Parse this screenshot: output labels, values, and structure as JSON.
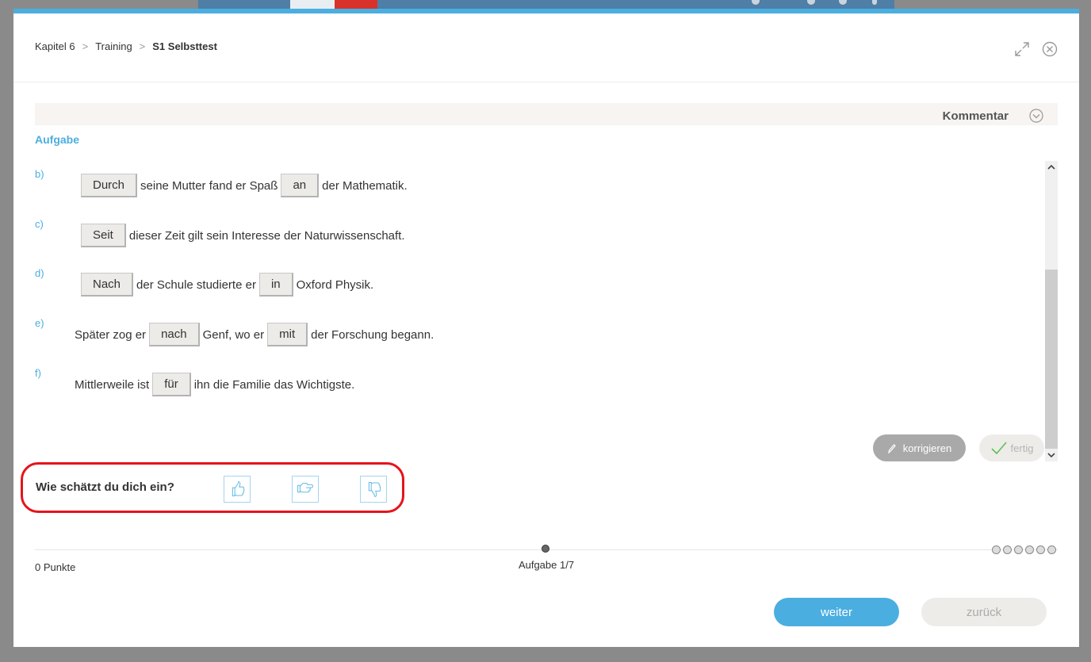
{
  "breadcrumb": [
    "Kapitel 6",
    "Training",
    "S1 Selbsttest"
  ],
  "icons": {
    "expand": "expand-icon",
    "close": "close-circle-icon",
    "chevron": "chevron-down-circle-icon",
    "pencil": "pencil-icon",
    "check": "check-icon"
  },
  "kommentar_label": "Kommentar",
  "aufgabe_label": "Aufgabe",
  "exercises": [
    {
      "label": "b)",
      "parts": [
        {
          "blank": "Durch"
        },
        {
          "text": "seine Mutter fand er Spaß"
        },
        {
          "blank": "an"
        },
        {
          "text": "der Mathematik."
        }
      ]
    },
    {
      "label": "c)",
      "parts": [
        {
          "blank": "Seit"
        },
        {
          "text": "dieser Zeit gilt sein Interesse der Naturwissenschaft."
        }
      ]
    },
    {
      "label": "d)",
      "parts": [
        {
          "blank": "Nach"
        },
        {
          "text": "der Schule studierte er"
        },
        {
          "blank": "in"
        },
        {
          "text": "Oxford Physik."
        }
      ]
    },
    {
      "label": "e)",
      "parts": [
        {
          "text": "Später zog er"
        },
        {
          "blank": "nach"
        },
        {
          "text": "Genf, wo er"
        },
        {
          "blank": "mit"
        },
        {
          "text": "der Forschung begann."
        }
      ]
    },
    {
      "label": "f)",
      "parts": [
        {
          "text": "Mittlerweile ist"
        },
        {
          "blank": "für"
        },
        {
          "text": "ihn die Familie das Wichtigste."
        }
      ]
    }
  ],
  "buttons": {
    "korrigieren": "korrigieren",
    "fertig": "fertig",
    "weiter": "weiter",
    "zurueck": "zurück"
  },
  "self_eval": {
    "question": "Wie schätzt du dich ein?",
    "options": [
      "thumbs-up-icon",
      "thumbs-sideways-icon",
      "thumbs-down-icon"
    ]
  },
  "progress": {
    "punkte": "0 Punkte",
    "aufgabe": "Aufgabe 1/7",
    "dots": 6
  },
  "colors": {
    "accent": "#4baee0",
    "highlight": "#e5141b"
  }
}
